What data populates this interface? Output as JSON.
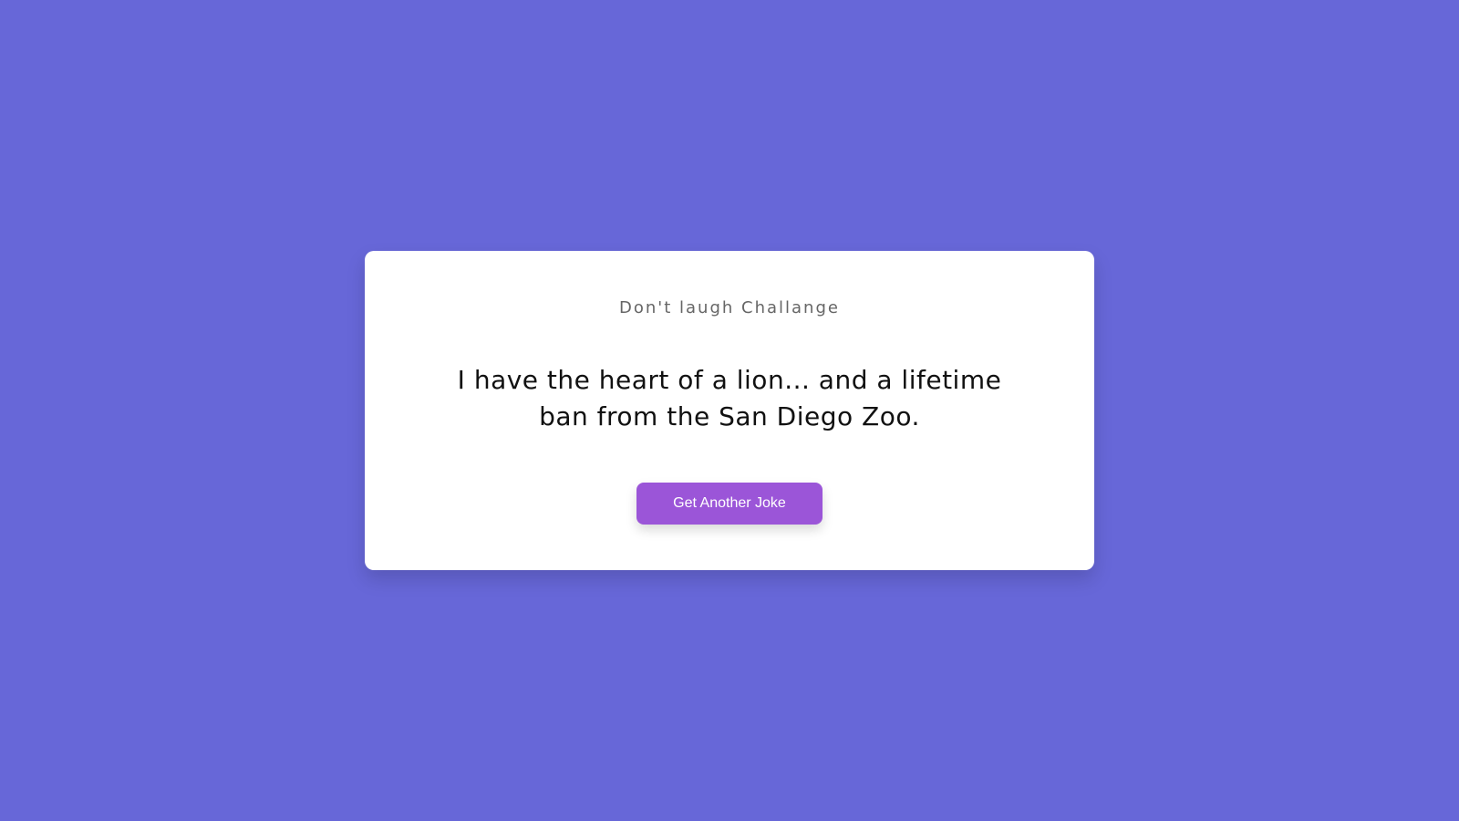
{
  "colors": {
    "background": "#6767d8",
    "card": "#ffffff",
    "button": "#9b55d8"
  },
  "card": {
    "title": "Don't laugh Challange",
    "joke": "I have the heart of a lion... and a lifetime ban from the San Diego Zoo.",
    "button_label": "Get Another Joke"
  }
}
